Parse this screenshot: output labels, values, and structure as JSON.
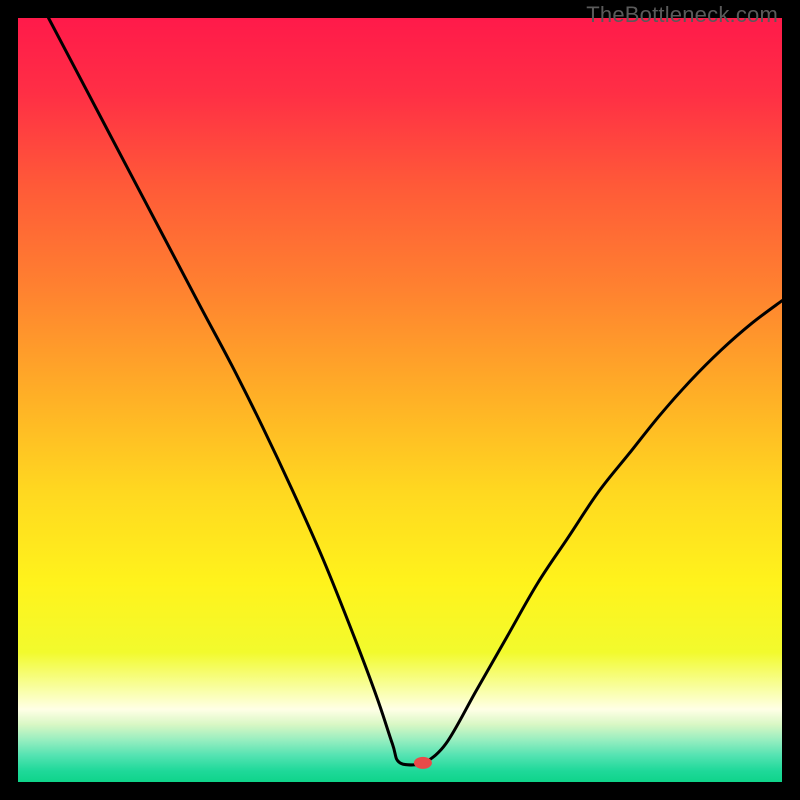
{
  "watermark": "TheBottleneck.com",
  "chart_data": {
    "type": "line",
    "title": "",
    "xlabel": "",
    "ylabel": "",
    "xlim": [
      0,
      100
    ],
    "ylim": [
      0,
      100
    ],
    "grid": false,
    "legend": false,
    "marker": {
      "x": 53,
      "y": 2.5,
      "color": "#e94a49",
      "rx": 9,
      "ry": 6
    },
    "curve_left": [
      {
        "x": 4,
        "y": 100
      },
      {
        "x": 9,
        "y": 90.5
      },
      {
        "x": 14,
        "y": 81
      },
      {
        "x": 19,
        "y": 71.5
      },
      {
        "x": 24,
        "y": 62
      },
      {
        "x": 28,
        "y": 54.5
      },
      {
        "x": 32,
        "y": 46.5
      },
      {
        "x": 36,
        "y": 38
      },
      {
        "x": 40,
        "y": 29
      },
      {
        "x": 44,
        "y": 19
      },
      {
        "x": 47,
        "y": 11
      },
      {
        "x": 49,
        "y": 5
      },
      {
        "x": 50,
        "y": 2.5
      },
      {
        "x": 53,
        "y": 2.3
      }
    ],
    "curve_right": [
      {
        "x": 53,
        "y": 2.3
      },
      {
        "x": 56,
        "y": 5
      },
      {
        "x": 60,
        "y": 12
      },
      {
        "x": 64,
        "y": 19
      },
      {
        "x": 68,
        "y": 26
      },
      {
        "x": 72,
        "y": 32
      },
      {
        "x": 76,
        "y": 38
      },
      {
        "x": 80,
        "y": 43
      },
      {
        "x": 84,
        "y": 48
      },
      {
        "x": 88,
        "y": 52.5
      },
      {
        "x": 92,
        "y": 56.5
      },
      {
        "x": 96,
        "y": 60
      },
      {
        "x": 100,
        "y": 63
      }
    ],
    "gradient_stops": [
      {
        "offset": 0.0,
        "color": "#ff1a4a"
      },
      {
        "offset": 0.1,
        "color": "#ff2f45"
      },
      {
        "offset": 0.22,
        "color": "#ff5a38"
      },
      {
        "offset": 0.35,
        "color": "#ff8030"
      },
      {
        "offset": 0.5,
        "color": "#ffb126"
      },
      {
        "offset": 0.62,
        "color": "#ffd820"
      },
      {
        "offset": 0.74,
        "color": "#fff31c"
      },
      {
        "offset": 0.83,
        "color": "#f2fa2d"
      },
      {
        "offset": 0.88,
        "color": "#f9ffa8"
      },
      {
        "offset": 0.905,
        "color": "#ffffe6"
      },
      {
        "offset": 0.925,
        "color": "#d8f7c4"
      },
      {
        "offset": 0.945,
        "color": "#97eec0"
      },
      {
        "offset": 0.965,
        "color": "#55e3b2"
      },
      {
        "offset": 0.985,
        "color": "#1fd99a"
      },
      {
        "offset": 1.0,
        "color": "#0fd48a"
      }
    ]
  }
}
